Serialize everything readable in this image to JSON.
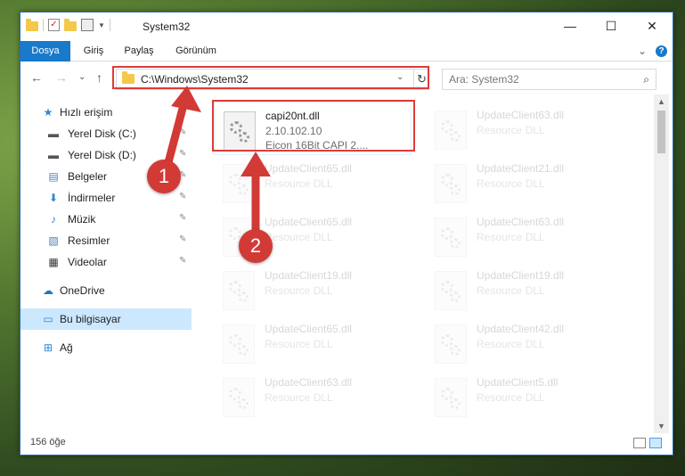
{
  "window": {
    "title": "System32",
    "minimize_glyph": "—",
    "maximize_glyph": "☐",
    "close_glyph": "✕"
  },
  "ribbon": {
    "tabs": [
      "Dosya",
      "Giriş",
      "Paylaş",
      "Görünüm"
    ],
    "expand_glyph": "⌄",
    "help_glyph": "?"
  },
  "nav": {
    "back_glyph": "←",
    "forward_glyph": "→",
    "recent_glyph": "⌄",
    "up_glyph": "↑",
    "address": "C:\\Windows\\System32",
    "dropdown_glyph": "⌄",
    "refresh_glyph": "↻",
    "search_placeholder": "Ara: System32",
    "search_glyph": "⌕"
  },
  "sidebar": {
    "items": [
      {
        "label": "Hızlı erişim",
        "icon": "star-icon",
        "glyph": "★",
        "color": "#2f86d6"
      },
      {
        "label": "Yerel Disk (C:)",
        "icon": "drive-icon",
        "glyph": "▬",
        "color": "#555555",
        "pinned": true
      },
      {
        "label": "Yerel Disk (D:)",
        "icon": "drive-icon",
        "glyph": "▬",
        "color": "#555555",
        "pinned": true
      },
      {
        "label": "Belgeler",
        "icon": "documents-icon",
        "glyph": "▤",
        "color": "#4a7fc1",
        "pinned": true
      },
      {
        "label": "İndirmeler",
        "icon": "download-icon",
        "glyph": "⬇",
        "color": "#2f86d6",
        "pinned": true
      },
      {
        "label": "Müzik",
        "icon": "music-icon",
        "glyph": "♪",
        "color": "#2f86d6",
        "pinned": true
      },
      {
        "label": "Resimler",
        "icon": "pictures-icon",
        "glyph": "▧",
        "color": "#4a7fc1",
        "pinned": true
      },
      {
        "label": "Videolar",
        "icon": "video-icon",
        "glyph": "▦",
        "color": "#333333",
        "pinned": true
      },
      {
        "label": "OneDrive",
        "icon": "cloud-icon",
        "glyph": "☁",
        "color": "#1979ca"
      },
      {
        "label": "Bu bilgisayar",
        "icon": "computer-icon",
        "glyph": "▭",
        "color": "#2f86d6",
        "selected": true
      },
      {
        "label": "Ağ",
        "icon": "network-icon",
        "glyph": "⊞",
        "color": "#2f86d6"
      }
    ],
    "pin_glyph": "✎"
  },
  "files": [
    {
      "name": "capi20nt.dll",
      "line1": "2.10.102.10",
      "line2": "Eicon 16Bit CAPI 2....",
      "highlighted": true
    },
    {
      "name": "UpdateClient63.dll",
      "line1": "Resource DLL"
    },
    {
      "name": "UpdateClient65.dll",
      "line1": "Resource DLL"
    },
    {
      "name": "UpdateClient21.dll",
      "line1": "Resource DLL"
    },
    {
      "name": "UpdateClient65.dll",
      "line1": "Resource DLL"
    },
    {
      "name": "UpdateClient63.dll",
      "line1": "Resource DLL"
    },
    {
      "name": "UpdateClient19.dll",
      "line1": "Resource DLL"
    },
    {
      "name": "UpdateClient19.dll",
      "line1": "Resource DLL"
    },
    {
      "name": "UpdateClient65.dll",
      "line1": "Resource DLL"
    },
    {
      "name": "UpdateClient42.dll",
      "line1": "Resource DLL"
    },
    {
      "name": "UpdateClient63.dll",
      "line1": "Resource DLL"
    },
    {
      "name": "UpdateClient5.dll",
      "line1": "Resource DLL"
    }
  ],
  "status": {
    "count": "156 öğe"
  },
  "annotations": {
    "badge1": "1",
    "badge2": "2",
    "color": "#d23a36"
  },
  "scroll": {
    "up_glyph": "▲",
    "down_glyph": "▼"
  }
}
